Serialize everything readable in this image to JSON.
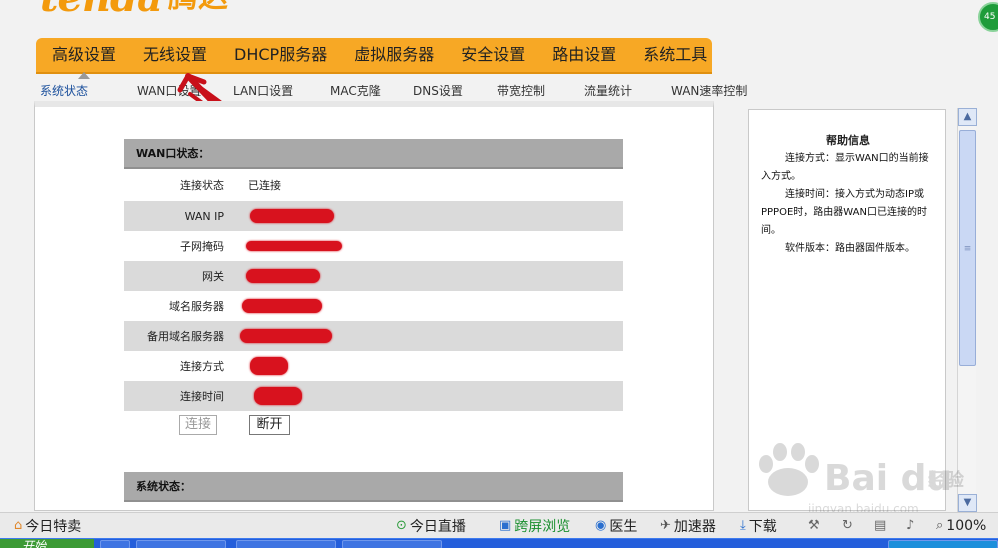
{
  "logo": {
    "text_en": "tenda",
    "text_cn": "腾达"
  },
  "notification_count": "45",
  "main_nav": [
    "高级设置",
    "无线设置",
    "DHCP服务器",
    "虚拟服务器",
    "安全设置",
    "路由设置",
    "系统工具"
  ],
  "sub_nav": [
    "系统状态",
    "WAN口设置",
    "LAN口设置",
    "MAC克隆",
    "DNS设置",
    "带宽控制",
    "流量统计",
    "WAN速率控制"
  ],
  "wan_status": {
    "title": "WAN口状态：",
    "rows": [
      {
        "label": "连接状态",
        "value": "已连接"
      },
      {
        "label": "WAN IP",
        "value": ""
      },
      {
        "label": "子网掩码",
        "value": ""
      },
      {
        "label": "网关",
        "value": ""
      },
      {
        "label": "域名服务器",
        "value": ""
      },
      {
        "label": "备用域名服务器",
        "value": ""
      },
      {
        "label": "连接方式",
        "value": ""
      },
      {
        "label": "连接时间",
        "value": ""
      }
    ],
    "connect_button": "连接",
    "disconnect_button": "断开"
  },
  "system_status": {
    "title": "系统状态："
  },
  "help": {
    "title": "帮助信息",
    "paragraphs": [
      "连接方式：显示WAN口的当前接入方式。",
      "连接时间：接入方式为动态IP或PPPOE时，路由器WAN口已连接的时间。",
      "软件版本：路由器固件版本。"
    ]
  },
  "statusbar": {
    "left": "今日特卖",
    "items": [
      "今日直播",
      "跨屏浏览",
      "医生",
      "加速器",
      "下载"
    ],
    "zoom": "100%"
  },
  "taskbar": {
    "start_label": "开始"
  },
  "watermark": {
    "brand": "Bai du",
    "cn": "经验",
    "url": "jingyan.baidu.com"
  },
  "colors": {
    "nav_orange": "#f7a825",
    "redaction": "#d8121e",
    "accent_blue": "#1a4f9c"
  }
}
